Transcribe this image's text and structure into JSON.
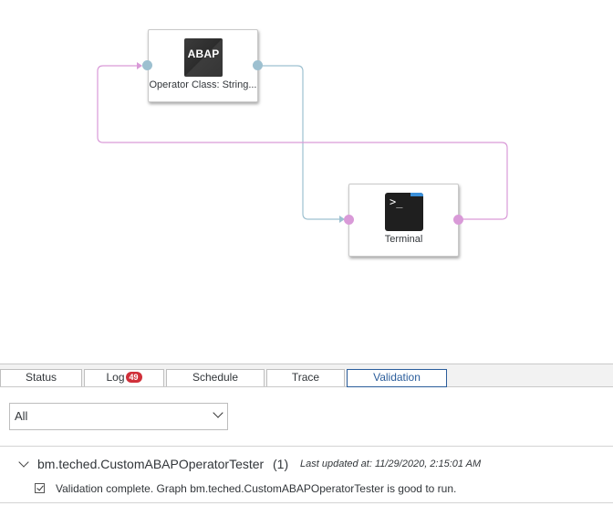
{
  "canvas": {
    "nodes": [
      {
        "id": "operator",
        "label": "Operator Class: String...",
        "icon": "abap-icon",
        "icon_text": "ABAP"
      },
      {
        "id": "terminal",
        "label": "Terminal",
        "icon": "terminal-icon",
        "icon_text": ">_"
      }
    ],
    "colors": {
      "port_blue": "#9dc0d0",
      "port_pink": "#d99ad8",
      "wire_blue": "#9dc0d0",
      "wire_pink": "#d99ad8"
    }
  },
  "tabs": [
    {
      "label": "Status"
    },
    {
      "label": "Log",
      "badge": "49"
    },
    {
      "label": "Schedule"
    },
    {
      "label": "Trace"
    },
    {
      "label": "Validation",
      "active": true
    }
  ],
  "validation": {
    "filter_value": "All",
    "group": {
      "graph_name": "bm.teched.CustomABAPOperatorTester",
      "count": "(1)",
      "last_updated": "Last updated at: 11/29/2020, 2:15:01 AM"
    },
    "result_text": "Validation complete. Graph bm.teched.CustomABAPOperatorTester is good to run."
  },
  "colors": {
    "accent": "#2b5d9b",
    "badge": "#d0303a"
  }
}
